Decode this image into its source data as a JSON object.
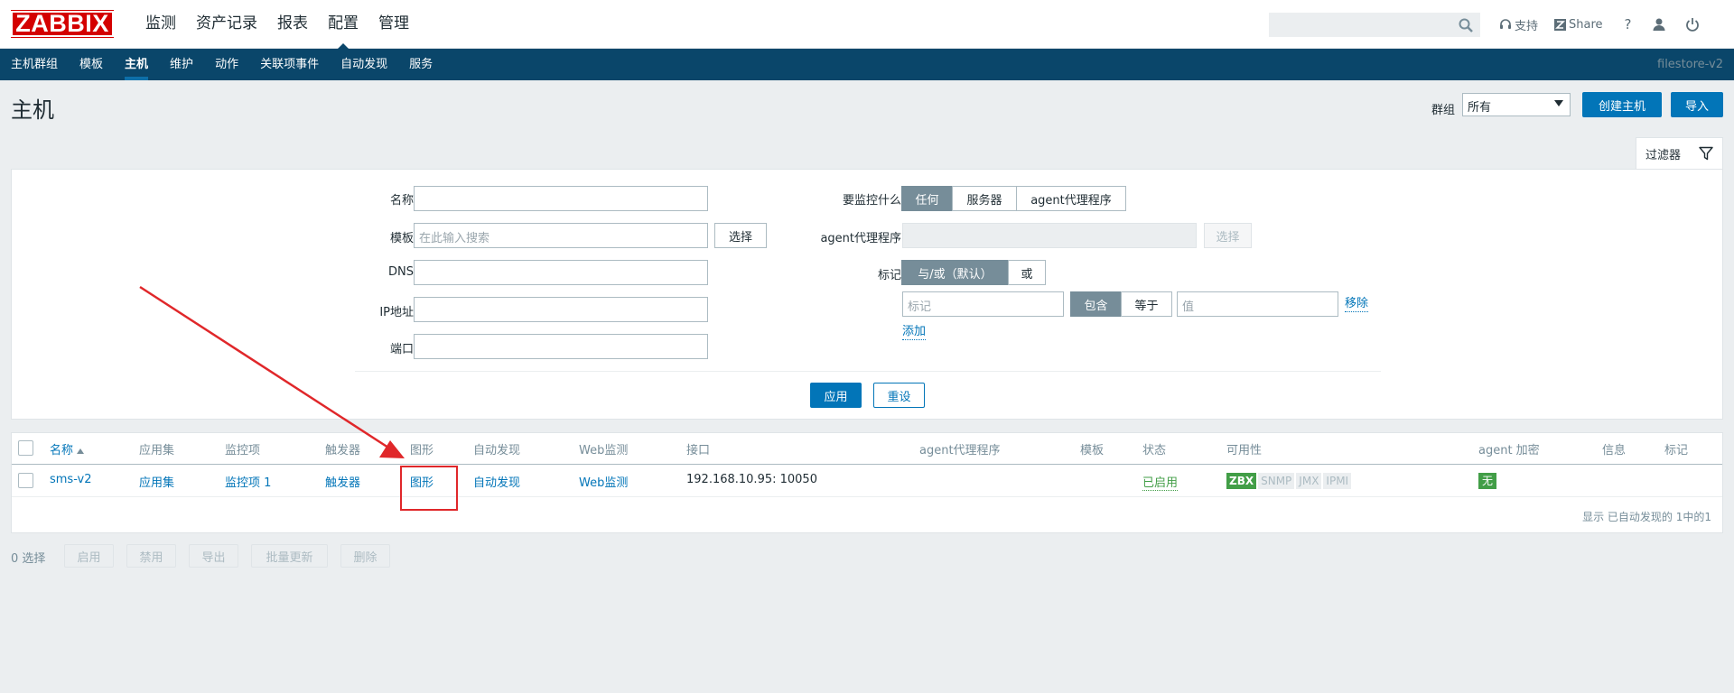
{
  "brand": "ZABBIX",
  "main_nav": [
    "监测",
    "资产记录",
    "报表",
    "配置",
    "管理"
  ],
  "top_links": {
    "support": "支持",
    "share": "Share",
    "help": "?"
  },
  "sub_nav": [
    "主机群组",
    "模板",
    "主机",
    "维护",
    "动作",
    "关联项事件",
    "自动发现",
    "服务"
  ],
  "server_name": "filestore-v2",
  "page_title": "主机",
  "group": {
    "label": "群组",
    "value": "所有"
  },
  "buttons": {
    "create_host": "创建主机",
    "import": "导入"
  },
  "filter": {
    "tab_label": "过滤器",
    "name_label": "名称",
    "template_label": "模板",
    "template_placeholder": "在此输入搜索",
    "template_select": "选择",
    "dns_label": "DNS",
    "ip_label": "IP地址",
    "port_label": "端口",
    "monitor_label": "要监控什么",
    "monitor_options": [
      "任何",
      "服务器",
      "agent代理程序"
    ],
    "proxy_label": "agent代理程序",
    "proxy_select": "选择",
    "tags_label": "标记",
    "tag_logic": [
      "与/或（默认）",
      "或"
    ],
    "tag_placeholder": "标记",
    "tag_ops": [
      "包含",
      "等于"
    ],
    "value_placeholder": "值",
    "remove": "移除",
    "add": "添加",
    "apply": "应用",
    "reset": "重设"
  },
  "table": {
    "headers": [
      "名称",
      "应用集",
      "监控项",
      "触发器",
      "图形",
      "自动发现",
      "Web监测",
      "接口",
      "agent代理程序",
      "模板",
      "状态",
      "可用性",
      "agent 加密",
      "信息",
      "标记"
    ],
    "row": {
      "name": "sms-v2",
      "apps": "应用集",
      "items": "监控项 1",
      "triggers": "触发器",
      "graphs": "图形",
      "discovery": "自动发现",
      "web": "Web监测",
      "interface": "192.168.10.95: 10050",
      "status": "已启用",
      "availability": [
        "ZBX",
        "SNMP",
        "JMX",
        "IPMI"
      ],
      "encryption": "无"
    },
    "footer": "显示 已自动发现的 1中的1"
  },
  "bottom": {
    "selected": "0 选择",
    "actions": [
      "启用",
      "禁用",
      "导出",
      "批量更新",
      "删除"
    ]
  }
}
